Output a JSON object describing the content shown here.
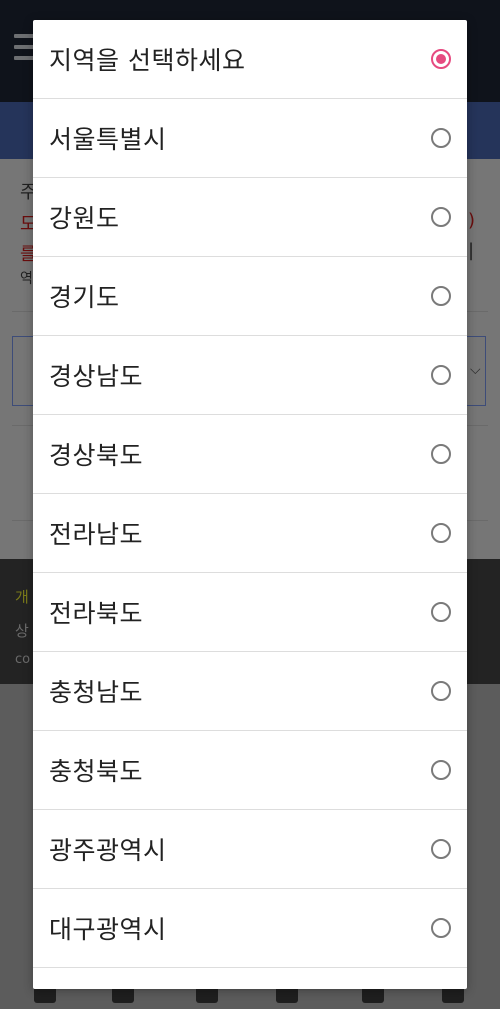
{
  "background": {
    "text_line_1": "주",
    "text_line_2": "도",
    "text_line_3": "를",
    "text_line_4": "역",
    "text_right_1": ")",
    "text_right_2": "|",
    "select_chevron": "⌵",
    "footer_line_1": "개",
    "footer_line_2": "상",
    "footer_line_3": "co"
  },
  "dialog": {
    "options": [
      {
        "label": "지역을 선택하세요",
        "selected": true
      },
      {
        "label": "서울특별시",
        "selected": false
      },
      {
        "label": "강원도",
        "selected": false
      },
      {
        "label": "경기도",
        "selected": false
      },
      {
        "label": "경상남도",
        "selected": false
      },
      {
        "label": "경상북도",
        "selected": false
      },
      {
        "label": "전라남도",
        "selected": false
      },
      {
        "label": "전라북도",
        "selected": false
      },
      {
        "label": "충청남도",
        "selected": false
      },
      {
        "label": "충청북도",
        "selected": false
      },
      {
        "label": "광주광역시",
        "selected": false
      },
      {
        "label": "대구광역시",
        "selected": false
      }
    ]
  },
  "colors": {
    "accent": "#e64a80",
    "radio_unselected": "#7a7a7a",
    "header_bg": "#0f131b",
    "navbar_bg": "#25345a"
  }
}
